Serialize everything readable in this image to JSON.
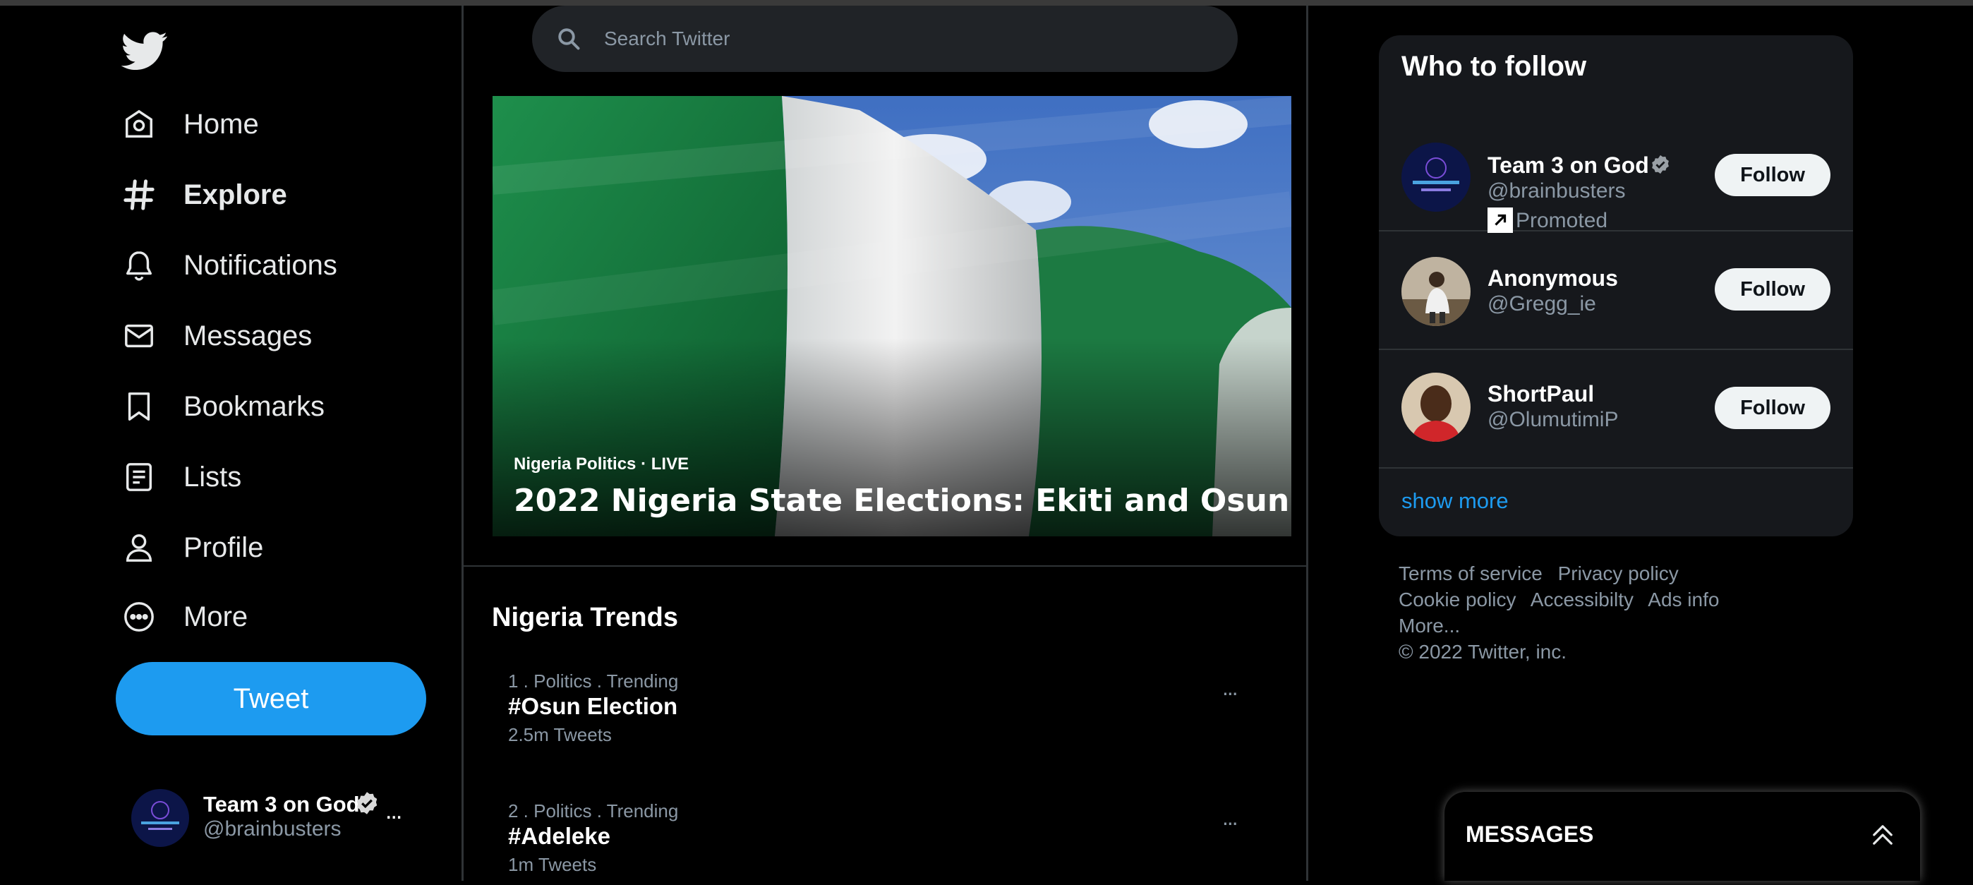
{
  "colors": {
    "background": "#000000",
    "accent": "#1d9bf0",
    "text_primary": "#e7e9ea",
    "text_secondary": "#8b98a5",
    "card_bg": "#16181c",
    "follow_button_bg": "#eff3f4"
  },
  "sidebar": {
    "logo_icon": "twitter-bird-icon",
    "items": [
      {
        "label": "Home",
        "icon": "home-icon"
      },
      {
        "label": "Explore",
        "icon": "hashtag-icon",
        "active": true
      },
      {
        "label": "Notifications",
        "icon": "bell-icon"
      },
      {
        "label": "Messages",
        "icon": "envelope-icon"
      },
      {
        "label": "Bookmarks",
        "icon": "bookmark-icon"
      },
      {
        "label": "Lists",
        "icon": "list-icon"
      },
      {
        "label": "Profile",
        "icon": "person-icon"
      },
      {
        "label": "More",
        "icon": "more-circle-icon"
      }
    ],
    "tweet_label": "Tweet",
    "account": {
      "name": "Team 3 on God",
      "handle": "@brainbusters",
      "verified": true,
      "more": "..."
    }
  },
  "search": {
    "placeholder": "Search Twitter"
  },
  "hero": {
    "category": "Nigeria Politics",
    "separator": "·",
    "status": "LIVE",
    "title": "2022 Nigeria State Elections: Ekiti and Osun"
  },
  "trends": {
    "title": "Nigeria Trends",
    "items": [
      {
        "meta": "1 . Politics . Trending",
        "name": "#Osun Election",
        "count": "2.5m Tweets",
        "more": "..."
      },
      {
        "meta": "2 . Politics . Trending",
        "name": "#Adeleke",
        "count": "1m Tweets",
        "more": "..."
      }
    ]
  },
  "who_to_follow": {
    "title": "Who to follow",
    "users": [
      {
        "name": "Team 3 on God",
        "handle": "@brainbusters",
        "verified": true,
        "promoted": "Promoted",
        "button": "Follow"
      },
      {
        "name": "Anonymous",
        "handle": "@Gregg_ie",
        "button": "Follow"
      },
      {
        "name": "ShortPaul",
        "handle": "@OlumutimiP",
        "button": "Follow"
      }
    ],
    "show_more": "show more"
  },
  "footer": {
    "links": [
      "Terms of service",
      "Privacy policy",
      "Cookie policy",
      "Accessibilty",
      "Ads info",
      "More..."
    ],
    "copyright": "© 2022 Twitter, inc."
  },
  "messages_drawer": {
    "title": "MESSAGES",
    "toggle_icon": "double-chevron-up-icon"
  }
}
